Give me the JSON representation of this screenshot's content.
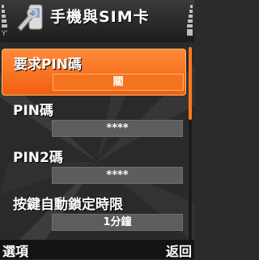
{
  "header": {
    "title": "手機與SIM卡",
    "icon": "wrench-phone-icon"
  },
  "settings": [
    {
      "label": "要求PIN碼",
      "value": "關",
      "selected": true
    },
    {
      "label": "PIN碼",
      "value": "****",
      "selected": false
    },
    {
      "label": "PIN2碼",
      "value": "****",
      "selected": false
    },
    {
      "label": "按鍵自動鎖定時限",
      "value": "1分鐘",
      "selected": false
    }
  ],
  "softkeys": {
    "left": "選項",
    "right": "返回"
  },
  "colors": {
    "accent": "#f06010",
    "background": "#2b2b2b",
    "value_box": "#5d5d5d"
  }
}
